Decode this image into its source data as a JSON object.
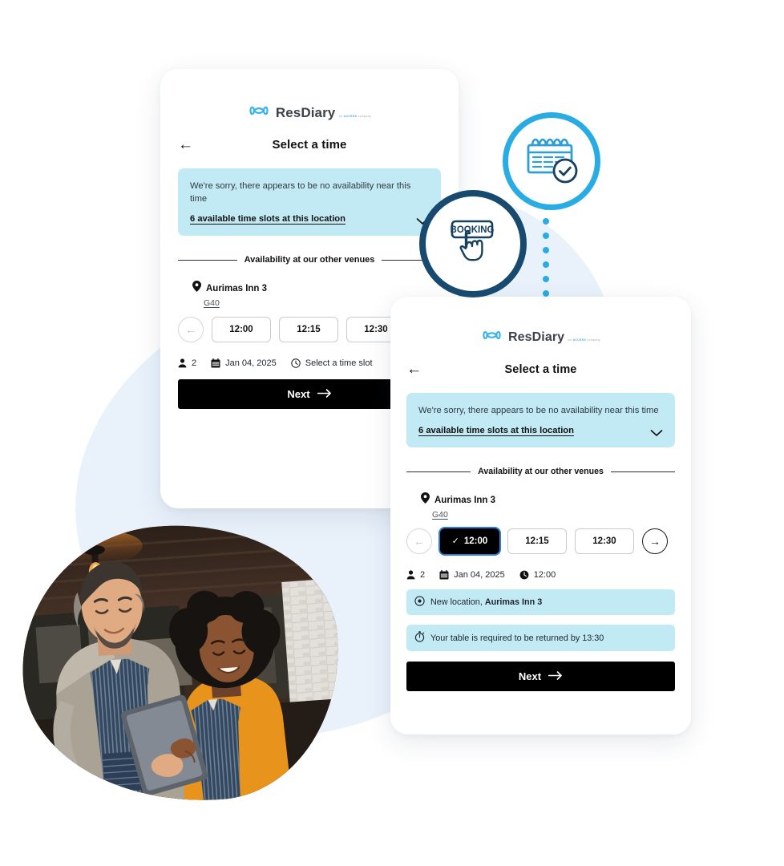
{
  "brand": {
    "name": "ResDiary",
    "tagline_pre": "an",
    "tagline_brand": "ACCESS",
    "tagline_post": "company",
    "logo_icon": "resdiary-bowtie-logo",
    "accent_light": "#29ace3",
    "accent_dark": "#174a6e",
    "notice_bg": "#c2eaf5"
  },
  "card_back": {
    "header": {
      "back_icon": "arrow-left-icon",
      "title": "Select a time"
    },
    "notice": {
      "message": "We're sorry, there appears to be no availability near this time",
      "link": "6 available time slots at this location",
      "chevron_icon": "chevron-down-icon"
    },
    "divider_label": "Availability at our other venues",
    "venue": {
      "pin_icon": "location-pin-icon",
      "name": "Aurimas Inn 3",
      "area": "G40"
    },
    "slots": {
      "prev_icon": "arrow-left-circle-icon",
      "items": [
        {
          "time": "12:00",
          "selected": false
        },
        {
          "time": "12:15",
          "selected": false
        },
        {
          "time": "12:30",
          "selected": false
        }
      ]
    },
    "meta": [
      {
        "icon": "person-icon",
        "value": "2"
      },
      {
        "icon": "calendar-icon",
        "value": "Jan 04, 2025"
      },
      {
        "icon": "clock-icon",
        "value": "Select a time slot"
      }
    ],
    "next": {
      "label": "Next",
      "icon": "arrow-right-icon"
    }
  },
  "card_front": {
    "header": {
      "back_icon": "arrow-left-icon",
      "title": "Select a time"
    },
    "notice": {
      "message": "We're sorry, there appears to be no availability near this time",
      "link": "6 available time slots at this location",
      "chevron_icon": "chevron-down-icon"
    },
    "divider_label": "Availability at our other venues",
    "venue": {
      "pin_icon": "location-pin-icon",
      "name": "Aurimas Inn 3",
      "area": "G40"
    },
    "slots": {
      "prev_icon": "arrow-left-circle-icon",
      "next_icon": "arrow-right-circle-icon",
      "tick_icon": "check-icon",
      "items": [
        {
          "time": "12:00",
          "selected": true
        },
        {
          "time": "12:15",
          "selected": false
        },
        {
          "time": "12:30",
          "selected": false
        }
      ]
    },
    "meta": [
      {
        "icon": "person-icon",
        "value": "2"
      },
      {
        "icon": "calendar-icon",
        "value": "Jan 04, 2025"
      },
      {
        "icon": "clock-icon",
        "value": "12:00"
      }
    ],
    "info_bars": [
      {
        "icon": "location-target-icon",
        "text_pre": "New location, ",
        "text_bold": "Aurimas Inn 3"
      },
      {
        "icon": "stopwatch-icon",
        "text_pre": "Your table is required to be returned by 13:30",
        "text_bold": ""
      }
    ],
    "next": {
      "label": "Next",
      "icon": "arrow-right-icon"
    }
  },
  "badges": {
    "calendar": {
      "icon": "calendar-check-icon",
      "ring_color": "#29ace3"
    },
    "booking": {
      "icon": "booking-button-cursor-icon",
      "label": "BOOKING",
      "ring_color": "#174a6e"
    }
  },
  "photo": {
    "alt": "two restaurant staff in striped aprons looking at a tablet"
  }
}
